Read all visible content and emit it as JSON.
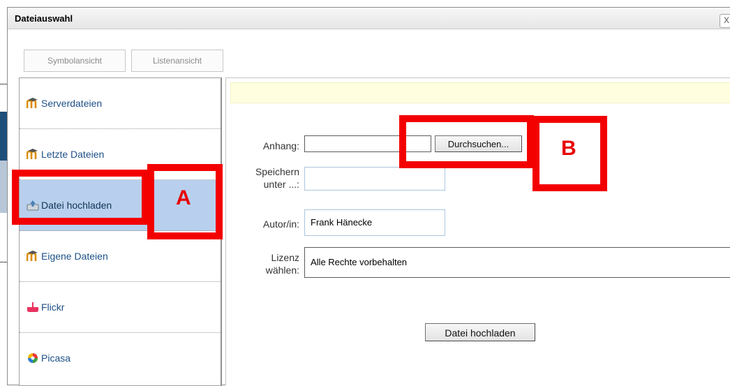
{
  "dialog": {
    "title": "Dateiauswahl",
    "close_label": "X"
  },
  "toolbar": {
    "symbol_view": "Symbolansicht",
    "list_view": "Listenansicht"
  },
  "sidebar": {
    "items": [
      {
        "label": "Serverdateien",
        "icon": "moodle-icon"
      },
      {
        "label": "Letzte Dateien",
        "icon": "moodle-icon"
      },
      {
        "label": "Datei hochladen",
        "icon": "upload-icon",
        "selected": true
      },
      {
        "label": "Eigene Dateien",
        "icon": "moodle-icon"
      },
      {
        "label": "Flickr",
        "icon": "flickr-icon"
      },
      {
        "label": "Picasa",
        "icon": "picasa-icon"
      }
    ]
  },
  "form": {
    "attachment_label": "Anhang:",
    "attachment_value": "",
    "browse_button": "Durchsuchen...",
    "save_as_label_1": "Speichern",
    "save_as_label_2": "unter ...:",
    "save_as_value": "",
    "author_label": "Autor/in:",
    "author_value": "Frank Hänecke",
    "license_label_1": "Lizenz",
    "license_label_2": "wählen:",
    "license_value": "Alle Rechte vorbehalten",
    "upload_button": "Datei hochladen"
  },
  "annotations": {
    "a": "A",
    "b": "B"
  },
  "colors": {
    "highlight": "#f30000",
    "selected_item": "#b8d0ed",
    "notice": "#ffffe0"
  }
}
